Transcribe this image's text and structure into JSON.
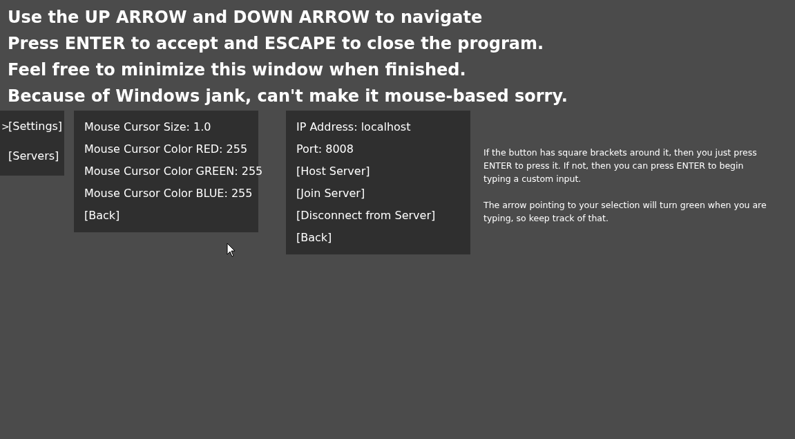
{
  "instructions": [
    "Use the UP ARROW and DOWN ARROW to navigate",
    "Press ENTER to accept and ESCAPE to close the program.",
    "Feel free to minimize this window when finished.",
    "Because of Windows jank, can't make it mouse-based sorry."
  ],
  "selection_marker": ">",
  "main_menu": [
    {
      "label": "[Settings]",
      "selected": true
    },
    {
      "label": "[Servers]",
      "selected": false
    }
  ],
  "settings_panel": [
    "Mouse Cursor Size: 1.0",
    "Mouse Cursor Color RED: 255",
    "Mouse Cursor Color GREEN: 255",
    "Mouse Cursor Color BLUE: 255",
    "[Back]"
  ],
  "servers_panel": [
    "IP Address: localhost",
    "Port: 8008",
    "[Host Server]",
    "[Join Server]",
    "[Disconnect from Server]",
    "[Back]"
  ],
  "help": [
    "If the button has square brackets around it, then you just press ENTER to press it. If not, then you can press ENTER to begin typing a custom input.",
    "The arrow pointing to your selection will turn green when you are typing, so keep track of that."
  ]
}
